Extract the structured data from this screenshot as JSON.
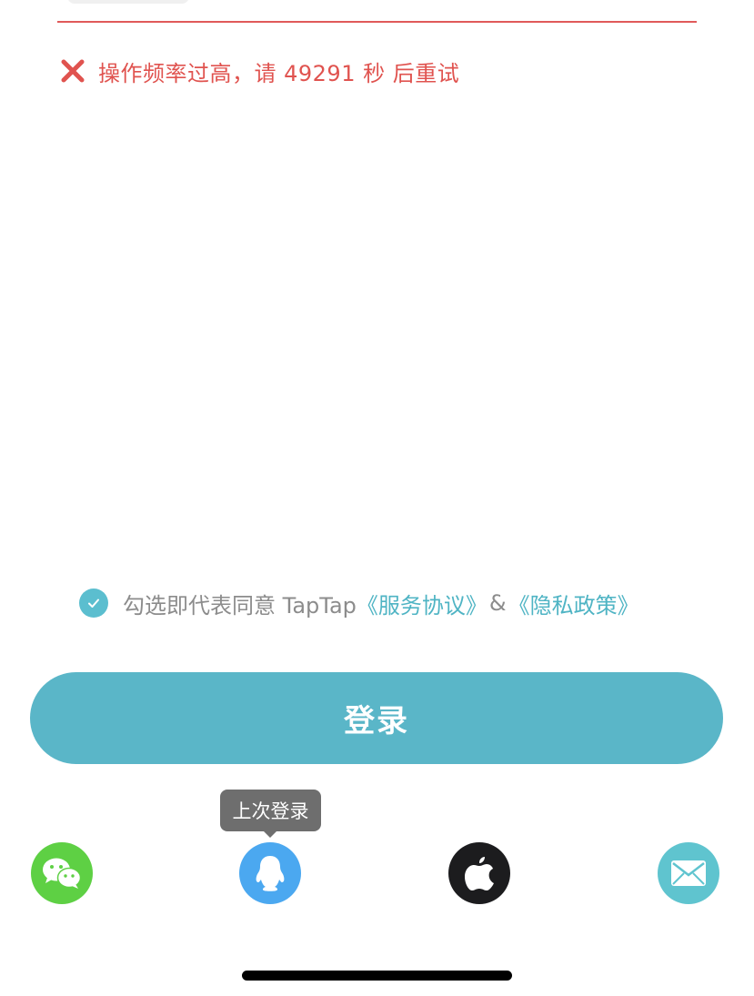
{
  "error": {
    "message": "操作频率过高，请 49291 秒 后重试",
    "icon": "close-x-icon",
    "color": "#e0534f"
  },
  "agreement": {
    "checked": true,
    "prefix": "勾选即代表同意 TapTap",
    "terms_link": "《服务协议》",
    "separator": "&",
    "privacy_link": "《隐私政策》",
    "link_color": "#4fb4c4"
  },
  "login_button": {
    "label": "登录",
    "color": "#5ab6c8"
  },
  "last_login_tooltip": {
    "label": "上次登录"
  },
  "social_login": [
    {
      "name": "wechat",
      "icon": "wechat-icon",
      "color": "#5ed044"
    },
    {
      "name": "qq",
      "icon": "qq-penguin-icon",
      "color": "#4ba8f0"
    },
    {
      "name": "apple",
      "icon": "apple-icon",
      "color": "#1c1c1e"
    },
    {
      "name": "email",
      "icon": "mail-icon",
      "color": "#5fc4cf"
    }
  ]
}
